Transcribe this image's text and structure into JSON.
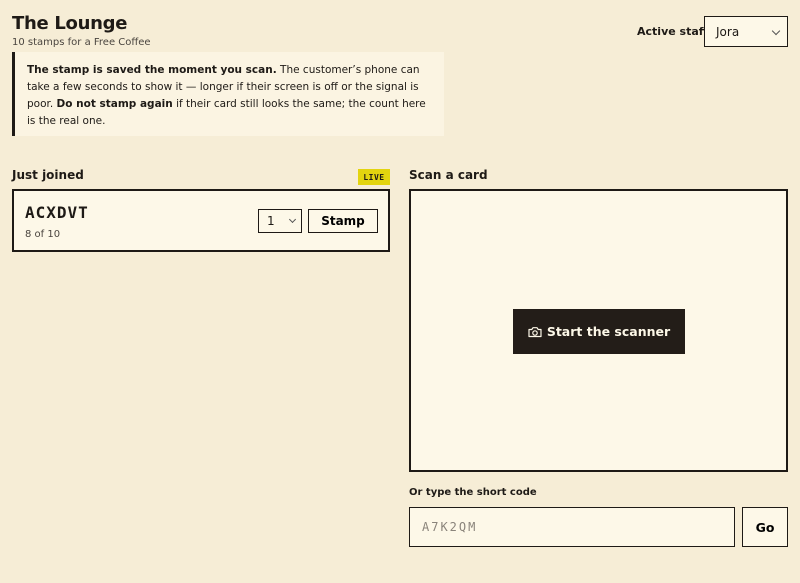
{
  "header": {
    "title": "The Lounge",
    "subtitle": "10 stamps for a Free Coffee",
    "staff_label": "Active staff",
    "staff_value": "Jora"
  },
  "notice": {
    "bold1": "The stamp is saved the moment you scan.",
    "text1": " The customer’s phone can take a few seconds to show it — longer if their screen is off or the signal is poor. ",
    "bold2": "Do not stamp again",
    "text2": " if their card still looks the same; the count here is the real one."
  },
  "just_joined": {
    "label": "Just joined",
    "badge": "LIVE",
    "cards": [
      {
        "code": "ACXDVT",
        "count": "8 of 10",
        "qty": "1",
        "stamp_label": "Stamp"
      }
    ]
  },
  "scan": {
    "label": "Scan a card",
    "start_label": "Start the scanner",
    "code_label": "Or type the short code",
    "code_placeholder": "A7K2QM",
    "go_label": "Go"
  },
  "colors": {
    "background": "#f6edd6",
    "panel": "#fdf8e8",
    "ink": "#1e1a16",
    "live_badge": "#e3d40f"
  }
}
